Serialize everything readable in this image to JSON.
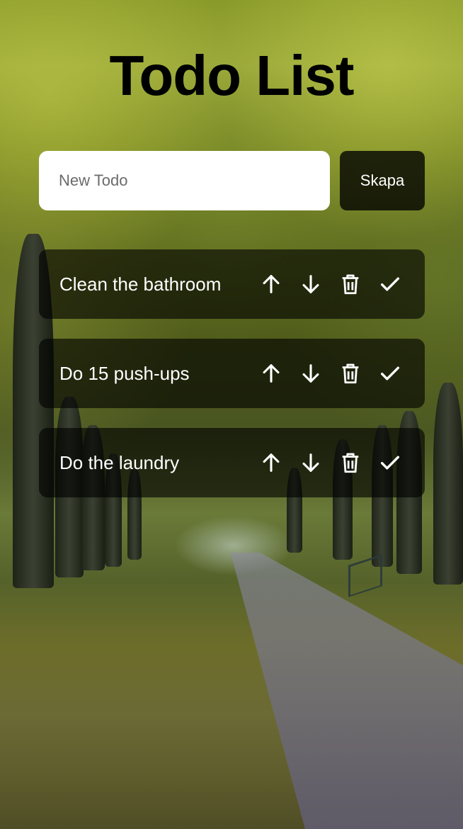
{
  "app": {
    "title": "Todo List"
  },
  "new_todo": {
    "placeholder": "New Todo",
    "value": "",
    "create_label": "Skapa"
  },
  "todos": [
    {
      "text": "Clean the bathroom"
    },
    {
      "text": "Do 15 push-ups"
    },
    {
      "text": "Do the laundry"
    }
  ],
  "icons": {
    "move_up": "arrow-up-icon",
    "move_down": "arrow-down-icon",
    "delete": "trash-icon",
    "complete": "check-icon"
  },
  "colors": {
    "title": "#000000",
    "item_background": "rgba(0,0,0,0.62)",
    "item_text": "#ffffff",
    "button_background": "rgba(0,0,0,0.78)",
    "input_background": "#ffffff"
  }
}
